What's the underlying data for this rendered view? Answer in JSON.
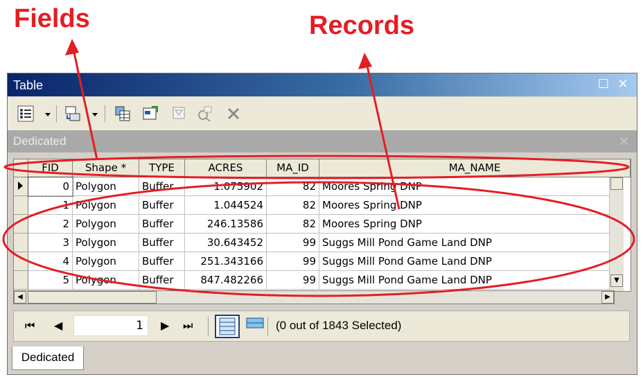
{
  "annotations": {
    "fields": "Fields",
    "records": "Records"
  },
  "window": {
    "title": "Table",
    "tab_name": "Dedicated",
    "bottom_tab": "Dedicated",
    "icons": [
      "table-options-icon",
      "related-tables-icon",
      "select-by-attributes-icon",
      "switch-selection-icon",
      "clear-selection-icon",
      "zoom-to-selected-icon",
      "delete-selected-icon"
    ]
  },
  "table": {
    "columns": [
      "FID",
      "Shape *",
      "TYPE",
      "ACRES",
      "MA_ID",
      "MA_NAME"
    ],
    "rows": [
      [
        "0",
        "Polygon",
        "Buffer",
        "1.075902",
        "82",
        "Moores Spring DNP"
      ],
      [
        "1",
        "Polygon",
        "Buffer",
        "1.044524",
        "82",
        "Moores Spring DNP"
      ],
      [
        "2",
        "Polygon",
        "Buffer",
        "246.13586",
        "82",
        "Moores Spring DNP"
      ],
      [
        "3",
        "Polygon",
        "Buffer",
        "30.643452",
        "99",
        "Suggs Mill Pond Game Land DNP"
      ],
      [
        "4",
        "Polygon",
        "Buffer",
        "251.343166",
        "99",
        "Suggs Mill Pond Game Land DNP"
      ],
      [
        "5",
        "Polygon",
        "Buffer",
        "847.482266",
        "99",
        "Suggs Mill Pond Game Land DNP"
      ]
    ]
  },
  "nav": {
    "current_record": "1",
    "status": "(0 out of 1843 Selected)"
  },
  "colors": {
    "annotation": "#e31e24",
    "title_start": "#0a246a",
    "title_end": "#a6caf0"
  }
}
